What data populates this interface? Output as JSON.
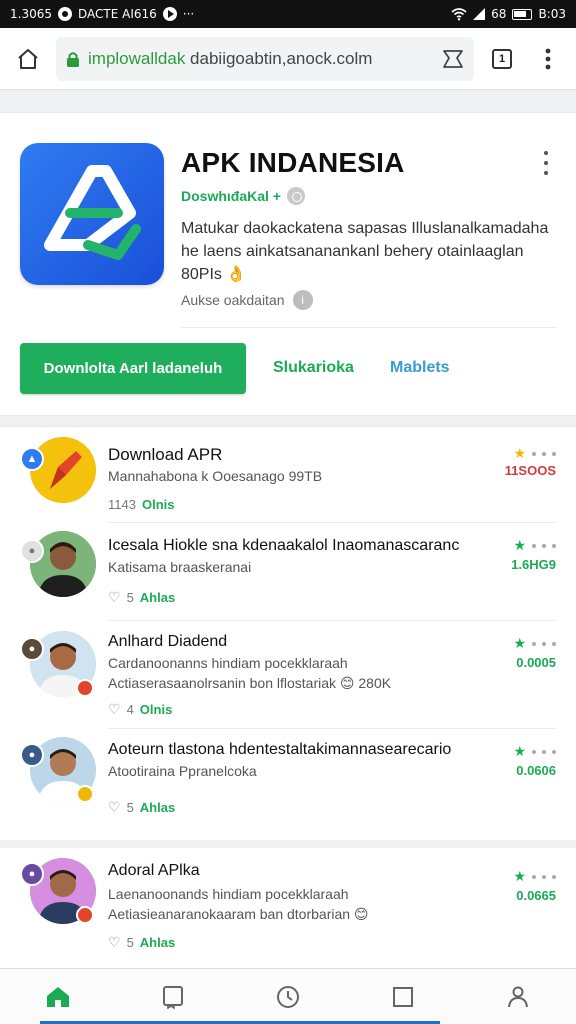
{
  "status_bar": {
    "time_left": "1.3065",
    "carrier": "DACTE AI616",
    "signal_text": "68",
    "time_right": "B:03"
  },
  "browser": {
    "url_host": "implowalldak",
    "url_rest": " dabiigoabtin,anock.colm"
  },
  "app": {
    "title": "APK INDANESIA",
    "developer": "DoswhıđaKal +",
    "description": "Matukar daokackatena sapasas Illuslanalkamadaha he laens ainkatsananankanl behery otainlaaglan 80PIs",
    "description_emoji": "👌",
    "sub_text": "Aukse oakdaitan",
    "install_label": "Downlolta Aarl ladaneluh",
    "link1_label": "Slukarioka",
    "link2_label": "Mablets",
    "brand_color": "#1fae5b"
  },
  "list": [
    {
      "title": "Download APR",
      "subtitle": "Mannahabona k Ooesanago 99TB",
      "meta_count": "1143",
      "meta_tag": "Olnis",
      "value": "11SOOS",
      "value_color": "#d23b3b",
      "star_color": "#f2b705"
    },
    {
      "title": "Icesala Hiokle sna kdenaakalol Inaomanascaranc",
      "subtitle": "Katisama braaskeranai",
      "meta_count": "5",
      "meta_tag": "Ahlas",
      "value": "1.6HG9",
      "value_color": "#1bab54",
      "star_color": "#1bab54"
    },
    {
      "title": "Anlhard Diadend",
      "subtitle": "Cardanoonanns hindiam pocekklaraah",
      "subtitle2": "Actiaserasaanolrsanin bon lflostariak 😊 280K",
      "meta_count": "4",
      "meta_tag": "Olnis",
      "value": "0.0005",
      "value_color": "#1bab54",
      "star_color": "#1bab54"
    },
    {
      "title": "Aoteurn tlastona hdentestaltakimannasearecario",
      "subtitle": "Atootiraina Ppranelcoka",
      "meta_count": "5",
      "meta_tag": "Ahlas",
      "value": "0.0606",
      "value_color": "#1bab54",
      "star_color": "#1bab54"
    },
    {
      "title": "Adoral APlka",
      "subtitle": "Laenanoonands hindiam pocekklaraah",
      "subtitle2": "Aetiasieanaranokaaram ban dtorbarian 😊",
      "meta_count": "5",
      "meta_tag": "Ahlas",
      "value": "0.0665",
      "value_color": "#1bab54",
      "star_color": "#1bab54"
    }
  ]
}
